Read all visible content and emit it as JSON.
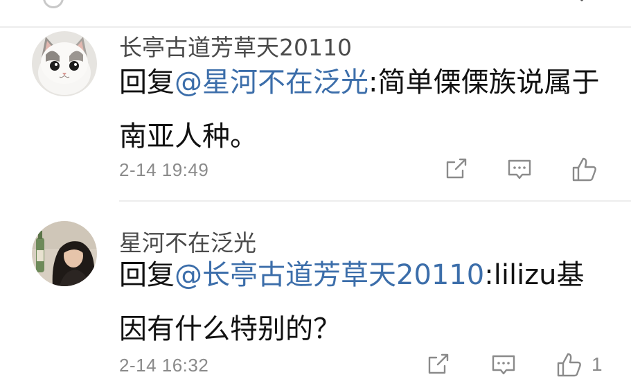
{
  "comments": [
    {
      "username": "长亭古道芳草天20110",
      "reply_prefix": "回复",
      "mention": "@星河不在泛光",
      "text": ":简单傈傈族说属于南亚人种。",
      "timestamp": "2-14 19:49",
      "avatar": "cat-avatar",
      "actions": {
        "share": "share-icon",
        "reply": "comment-icon",
        "like": "thumbs-up-icon"
      }
    },
    {
      "username": "星河不在泛光",
      "reply_prefix": "回复",
      "mention": "@长亭古道芳草天20110",
      "text": ":lilizu基因有什么特别的？",
      "timestamp": "2-14 16:32",
      "like_count": "1",
      "avatar": "woman-avatar",
      "actions": {
        "share": "share-icon",
        "reply": "comment-icon",
        "like": "thumbs-up-icon"
      }
    }
  ],
  "colors": {
    "mention": "#3c6eaa",
    "meta": "#8a8a8a",
    "username": "#4a4a4a"
  }
}
